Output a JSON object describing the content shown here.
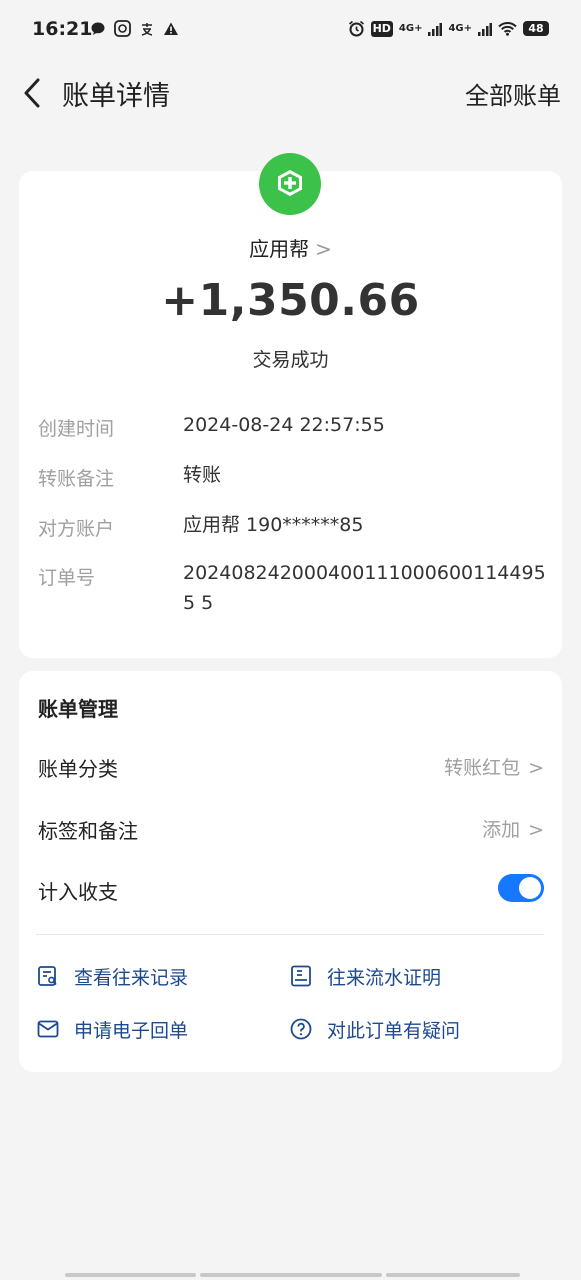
{
  "status_bar": {
    "time": "16:21",
    "left_icons": [
      "message-icon",
      "app-icon",
      "alipay-icon",
      "warning-icon"
    ],
    "hd_label": "HD",
    "net1": "4G+",
    "net2": "4G+",
    "battery": "48"
  },
  "header": {
    "title": "账单详情",
    "right_action": "全部账单"
  },
  "transaction": {
    "merchant": "应用帮",
    "merchant_chevron": ">",
    "amount": "+1,350.66",
    "status": "交易成功",
    "details": [
      {
        "label": "创建时间",
        "value": "2024-08-24 22:57:55"
      },
      {
        "label": "转账备注",
        "value": "转账"
      },
      {
        "label": "对方账户",
        "value": "应用帮 190******85"
      },
      {
        "label": "订单号",
        "value": "2024082420004001110006001144955 5"
      }
    ]
  },
  "management": {
    "title": "账单管理",
    "category_label": "账单分类",
    "category_value": "转账红包",
    "tags_label": "标签和备注",
    "tags_value": "添加",
    "count_label": "计入收支",
    "count_enabled": true,
    "chevron": ">",
    "links": [
      {
        "label": "查看往来记录",
        "icon": "record-search-icon"
      },
      {
        "label": "往来流水证明",
        "icon": "statement-icon"
      },
      {
        "label": "申请电子回单",
        "icon": "mail-icon"
      },
      {
        "label": "对此订单有疑问",
        "icon": "question-icon"
      }
    ]
  },
  "colors": {
    "accent": "#1677ff",
    "link": "#1d4a8f",
    "logo_green": "#3cc24a"
  }
}
